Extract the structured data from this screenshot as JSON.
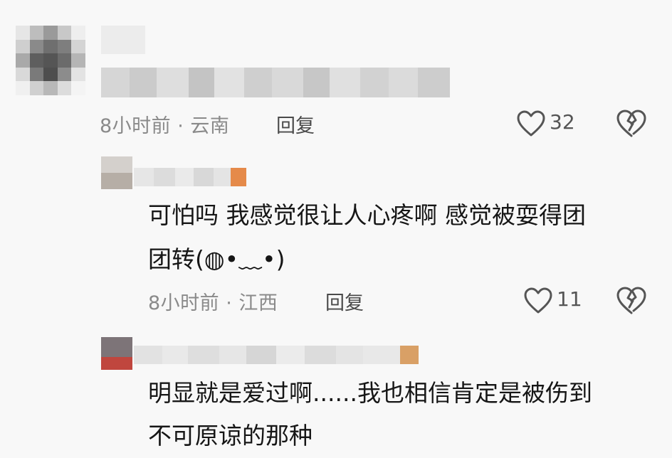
{
  "comments": [
    {
      "meta": "8小时前 · 云南",
      "reply": "回复",
      "likes": "32"
    },
    {
      "text_line1": "可怕吗 我感觉很让人心疼啊 感觉被耍得团",
      "text_line2": "团转(◍•﹏•)",
      "meta": "8小时前 · 江西",
      "reply": "回复",
      "likes": "11"
    },
    {
      "text_line1": "明显就是爱过啊......我也相信肯定是被伤到",
      "text_line2": "不可原谅的那种"
    }
  ],
  "icons": {
    "like": "heart-icon",
    "dislike": "broken-heart-icon"
  },
  "colors": {
    "background": "#f8f8f8",
    "meta_text": "#8a8a8a",
    "body_text": "#161616",
    "icon": "#555555"
  }
}
